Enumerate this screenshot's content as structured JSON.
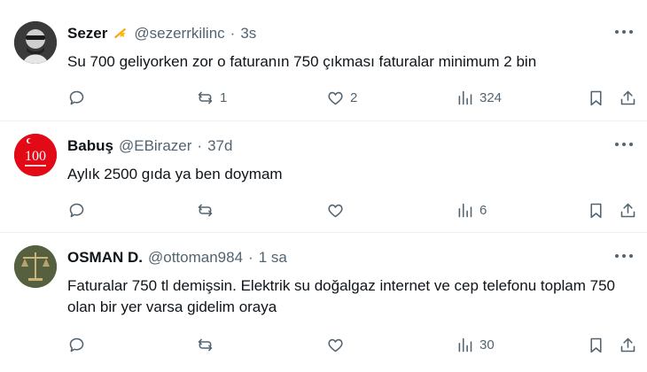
{
  "tweets": [
    {
      "name": "Sezer",
      "handle": "@sezerrkilinc",
      "time": "3s",
      "text": "Su 700 geliyorken zor o faturanın 750 çıkması faturalar minimum 2 bin",
      "replies": "",
      "reposts": "1",
      "likes": "2",
      "views": "324",
      "badge": "star-badge-icon"
    },
    {
      "name": "Babuş",
      "handle": "@EBirazer",
      "time": "37d",
      "text": "Aylık 2500 gıda ya ben doymam",
      "replies": "",
      "reposts": "",
      "likes": "",
      "views": "6"
    },
    {
      "name": "OSMAN D.",
      "handle": "@ottoman984",
      "time": "1 sa",
      "text": "Faturalar 750 tl demişsin. Elektrik su doğalgaz internet ve cep telefonu toplam 750 olan bir yer varsa gidelim oraya",
      "replies": "",
      "reposts": "",
      "likes": "",
      "views": "30"
    }
  ],
  "separator": "·",
  "avatar2_text": "100",
  "colors": {
    "text": "#0f1419",
    "muted": "#536471",
    "border": "#eff3f4"
  }
}
